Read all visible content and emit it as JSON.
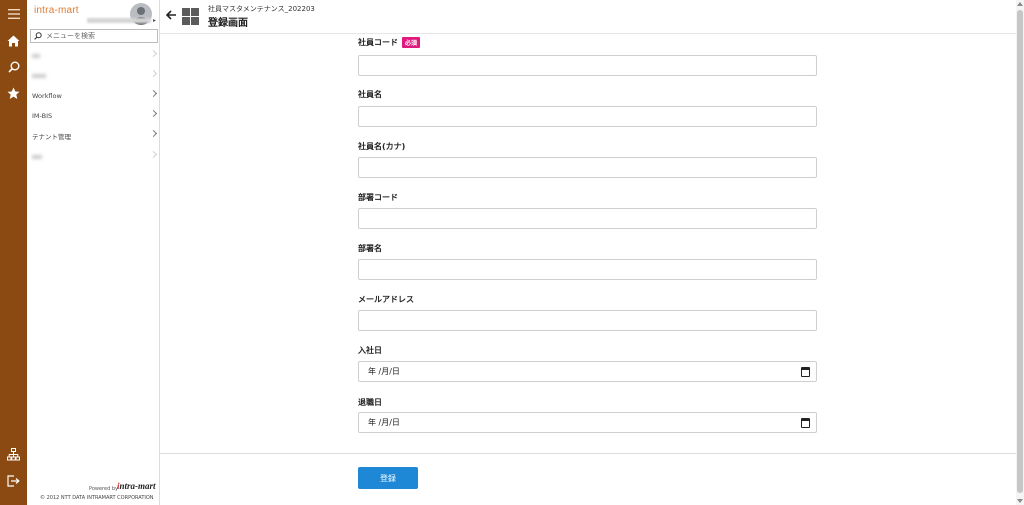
{
  "brand": {
    "name": "intra-mart"
  },
  "menu": {
    "search_placeholder": "メニューを検索",
    "items": [
      {
        "label": " ",
        "blurred": true
      },
      {
        "label": " ",
        "blurred": true
      },
      {
        "label": "Workflow",
        "blurred": false
      },
      {
        "label": "IM-BIS",
        "blurred": false
      },
      {
        "label": "テナント管理",
        "blurred": false
      },
      {
        "label": " ",
        "blurred": true
      }
    ],
    "powered_by": "Powered by",
    "logo_text": "intra-mart",
    "copyright": "© 2012 NTT DATA INTRAMART CORPORATION"
  },
  "header": {
    "subtitle": "社員マスタメンテナンス_202203",
    "title": "登録画面"
  },
  "form": {
    "fields": [
      {
        "label": "社員コード",
        "required_badge": "必須",
        "value": ""
      },
      {
        "label": "社員名",
        "value": ""
      },
      {
        "label": "社員名(カナ)",
        "value": ""
      },
      {
        "label": "部署コード",
        "value": ""
      },
      {
        "label": "部署名",
        "value": ""
      },
      {
        "label": "メールアドレス",
        "value": ""
      },
      {
        "label": "入社日",
        "date_placeholder": "年 /月/日"
      },
      {
        "label": "退職日",
        "date_placeholder": "年 /月/日"
      }
    ],
    "submit_label": "登録"
  },
  "colors": {
    "rail": "#8a4a12",
    "brand_orange": "#e07b2e",
    "required_badge": "#e0197d",
    "primary_button": "#1e88d6"
  },
  "icons": [
    "hamburger-icon",
    "home-icon",
    "search-icon",
    "star-icon",
    "sitemap-icon",
    "logout-icon",
    "back-arrow-icon",
    "apps-grid-icon",
    "calendar-icon"
  ]
}
